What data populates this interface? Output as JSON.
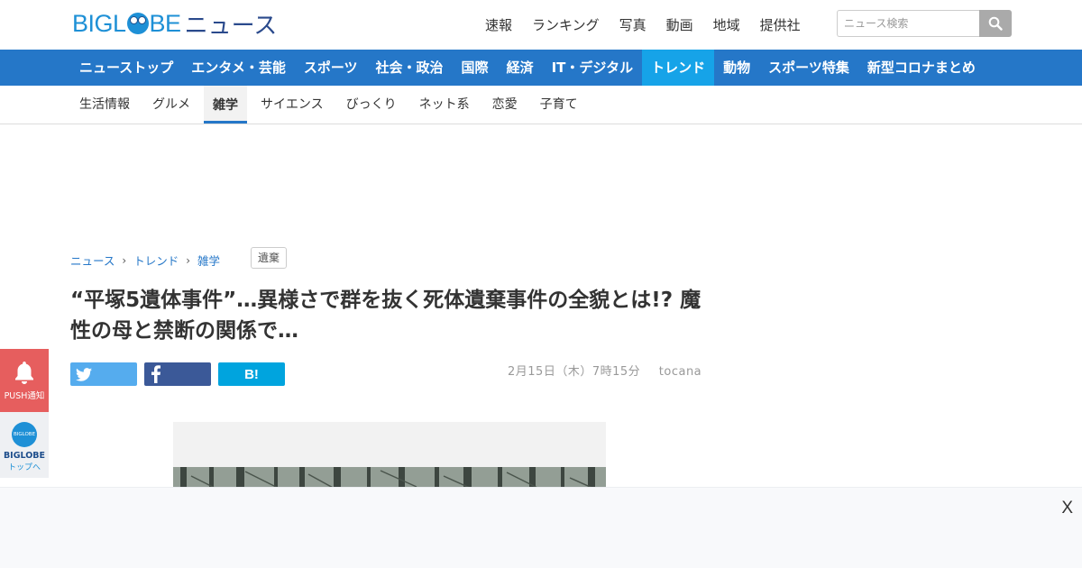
{
  "brand": {
    "logo_left": "BIGL",
    "logo_right": "BE",
    "logo_news": "ニュース"
  },
  "topnav": [
    "速報",
    "ランキング",
    "写真",
    "動画",
    "地域",
    "提供社"
  ],
  "search": {
    "placeholder": "ニュース検索"
  },
  "mainnav": [
    {
      "label": "ニューストップ",
      "active": false
    },
    {
      "label": "エンタメ・芸能",
      "active": false
    },
    {
      "label": "スポーツ",
      "active": false
    },
    {
      "label": "社会・政治",
      "active": false
    },
    {
      "label": "国際",
      "active": false
    },
    {
      "label": "経済",
      "active": false
    },
    {
      "label": "IT・デジタル",
      "active": false
    },
    {
      "label": "トレンド",
      "active": true
    },
    {
      "label": "動物",
      "active": false
    },
    {
      "label": "スポーツ特集",
      "active": false
    },
    {
      "label": "新型コロナまとめ",
      "active": false
    }
  ],
  "subnav": [
    {
      "label": "生活情報",
      "active": false
    },
    {
      "label": "グルメ",
      "active": false
    },
    {
      "label": "雑学",
      "active": true
    },
    {
      "label": "サイエンス",
      "active": false
    },
    {
      "label": "びっくり",
      "active": false
    },
    {
      "label": "ネット系",
      "active": false
    },
    {
      "label": "恋愛",
      "active": false
    },
    {
      "label": "子育て",
      "active": false
    }
  ],
  "breadcrumb": [
    "ニュース",
    "トレンド",
    "雑学"
  ],
  "tag": "遺棄",
  "article": {
    "title": "“平塚5遺体事件”…異様さで群を抜く死体遺棄事件の全貌とは!? 魔性の母と禁断の関係で…",
    "date": "2月15日（木）7時15分",
    "source": "tocana"
  },
  "share": {
    "hatena_label": "B!"
  },
  "side": {
    "push_label": "PUSH通知",
    "top_icon_text": "BIGLOBE",
    "top_brand": "BIGLOBE",
    "top_sub": "トップへ"
  },
  "ad": {
    "close_label": "X"
  },
  "colors": {
    "brand_blue": "#1e90d6",
    "nav_blue": "#2577c8",
    "nav_active": "#16a3e8",
    "push_red": "#e65e5e"
  }
}
